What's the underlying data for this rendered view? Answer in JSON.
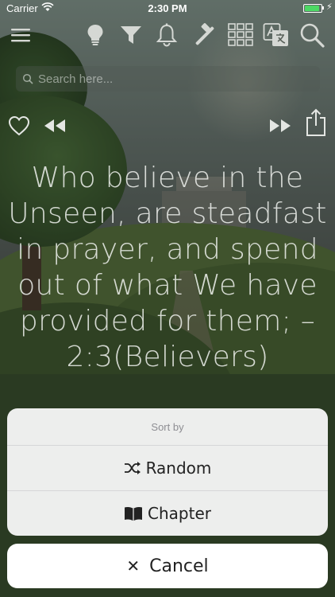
{
  "status_bar": {
    "carrier": "Carrier",
    "time": "2:30 PM",
    "battery_level": 0.9,
    "battery_color": "#4cd964"
  },
  "toolbar": {
    "icons": [
      "menu-icon",
      "lightbulb-icon",
      "filter-icon",
      "bell-icon",
      "gavel-icon",
      "grid-icon",
      "translate-icon",
      "search-icon"
    ]
  },
  "search": {
    "placeholder": "Search here..."
  },
  "player": {
    "icons": [
      "heart-icon",
      "rewind-icon",
      "fast-forward-icon",
      "share-icon"
    ]
  },
  "verse": {
    "text": "Who believe in the Unseen, are steadfast in prayer, and spend out of what We have provided for them; – 2:3(Believers)"
  },
  "action_sheet": {
    "title": "Sort by",
    "options": [
      {
        "label": "Random",
        "icon": "shuffle-icon"
      },
      {
        "label": "Chapter",
        "icon": "book-icon"
      }
    ],
    "cancel_label": "Cancel",
    "cancel_icon": "close-icon"
  }
}
